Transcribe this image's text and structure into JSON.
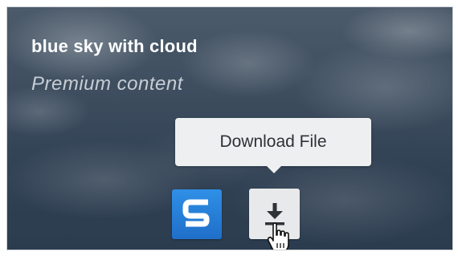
{
  "asset": {
    "title": "blue sky with cloud",
    "license_label": "Premium content"
  },
  "tooltip": {
    "text": "Download File"
  },
  "actions": {
    "snagit_icon": "snagit-s-logo-icon",
    "download_icon": "download-arrow-icon",
    "cursor_icon": "hand-pointer-icon"
  },
  "colors": {
    "snagit_blue": "#2a86dd",
    "tooltip_bg": "#eeeff0",
    "download_bg": "#e8e9ea",
    "title_text": "#ffffff",
    "subtitle_text": "#c7cdd4"
  }
}
